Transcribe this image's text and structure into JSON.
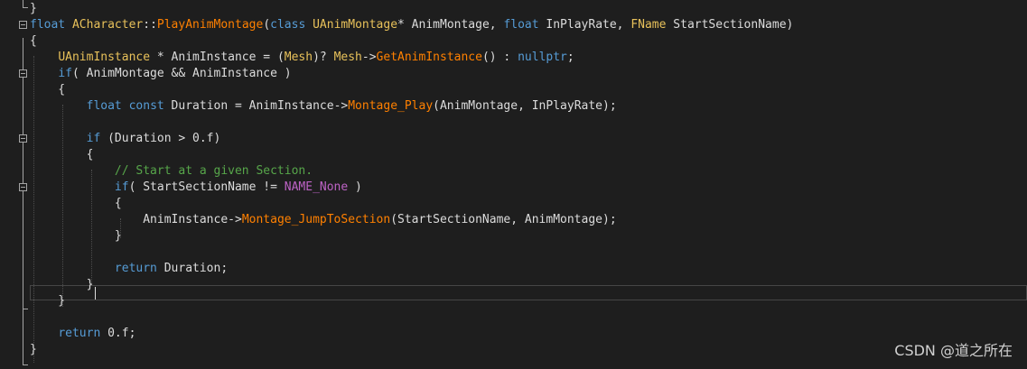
{
  "editor": {
    "background": "#1e1e1e",
    "colors": {
      "keyword": "#569cd6",
      "type": "#e8c15a",
      "function": "#ff8000",
      "plain": "#dcdcdc",
      "comment": "#57a64a",
      "macro": "#bd63c5"
    },
    "lines": [
      {
        "tokens": [
          {
            "t": "pl",
            "v": "}"
          }
        ]
      },
      {
        "tokens": [
          {
            "t": "kw",
            "v": "float"
          },
          {
            "t": "pl",
            "v": " "
          },
          {
            "t": "ty",
            "v": "ACharacter"
          },
          {
            "t": "pl",
            "v": "::"
          },
          {
            "t": "fn",
            "v": "PlayAnimMontage"
          },
          {
            "t": "pl",
            "v": "("
          },
          {
            "t": "kw",
            "v": "class"
          },
          {
            "t": "pl",
            "v": " "
          },
          {
            "t": "ty",
            "v": "UAnimMontage"
          },
          {
            "t": "pl",
            "v": "* AnimMontage, "
          },
          {
            "t": "kw",
            "v": "float"
          },
          {
            "t": "pl",
            "v": " InPlayRate, "
          },
          {
            "t": "ty",
            "v": "FName"
          },
          {
            "t": "pl",
            "v": " StartSectionName)"
          }
        ]
      },
      {
        "tokens": [
          {
            "t": "pl",
            "v": "{"
          }
        ]
      },
      {
        "tokens": [
          {
            "t": "pl",
            "v": "    "
          },
          {
            "t": "ty",
            "v": "UAnimInstance"
          },
          {
            "t": "pl",
            "v": " * AnimInstance = ("
          },
          {
            "t": "ty",
            "v": "Mesh"
          },
          {
            "t": "pl",
            "v": ")? "
          },
          {
            "t": "ty",
            "v": "Mesh"
          },
          {
            "t": "pl",
            "v": "->"
          },
          {
            "t": "fn",
            "v": "GetAnimInstance"
          },
          {
            "t": "pl",
            "v": "() : "
          },
          {
            "t": "kw",
            "v": "nullptr"
          },
          {
            "t": "pl",
            "v": ";"
          }
        ]
      },
      {
        "tokens": [
          {
            "t": "pl",
            "v": "    "
          },
          {
            "t": "kw",
            "v": "if"
          },
          {
            "t": "pl",
            "v": "( AnimMontage && AnimInstance )"
          }
        ]
      },
      {
        "tokens": [
          {
            "t": "pl",
            "v": "    {"
          }
        ]
      },
      {
        "tokens": [
          {
            "t": "pl",
            "v": "        "
          },
          {
            "t": "kw",
            "v": "float"
          },
          {
            "t": "pl",
            "v": " "
          },
          {
            "t": "kw",
            "v": "const"
          },
          {
            "t": "pl",
            "v": " Duration = AnimInstance->"
          },
          {
            "t": "fn",
            "v": "Montage_Play"
          },
          {
            "t": "pl",
            "v": "(AnimMontage, InPlayRate);"
          }
        ]
      },
      {
        "tokens": []
      },
      {
        "tokens": [
          {
            "t": "pl",
            "v": "        "
          },
          {
            "t": "kw",
            "v": "if"
          },
          {
            "t": "pl",
            "v": " (Duration > 0.f)"
          }
        ]
      },
      {
        "tokens": [
          {
            "t": "pl",
            "v": "        {"
          }
        ]
      },
      {
        "tokens": [
          {
            "t": "pl",
            "v": "            "
          },
          {
            "t": "cm",
            "v": "// Start at a given Section."
          }
        ]
      },
      {
        "tokens": [
          {
            "t": "pl",
            "v": "            "
          },
          {
            "t": "kw",
            "v": "if"
          },
          {
            "t": "pl",
            "v": "( StartSectionName != "
          },
          {
            "t": "mc",
            "v": "NAME_None"
          },
          {
            "t": "pl",
            "v": " )"
          }
        ]
      },
      {
        "tokens": [
          {
            "t": "pl",
            "v": "            {"
          }
        ]
      },
      {
        "tokens": [
          {
            "t": "pl",
            "v": "                AnimInstance->"
          },
          {
            "t": "fn",
            "v": "Montage_JumpToSection"
          },
          {
            "t": "pl",
            "v": "(StartSectionName, AnimMontage);"
          }
        ]
      },
      {
        "tokens": [
          {
            "t": "pl",
            "v": "            }"
          }
        ]
      },
      {
        "tokens": []
      },
      {
        "tokens": [
          {
            "t": "pl",
            "v": "            "
          },
          {
            "t": "kw",
            "v": "return"
          },
          {
            "t": "pl",
            "v": " Duration;"
          }
        ]
      },
      {
        "tokens": [
          {
            "t": "pl",
            "v": "        }"
          }
        ]
      },
      {
        "tokens": [
          {
            "t": "pl",
            "v": "    }"
          }
        ]
      },
      {
        "tokens": []
      },
      {
        "tokens": [
          {
            "t": "pl",
            "v": "    "
          },
          {
            "t": "kw",
            "v": "return"
          },
          {
            "t": "pl",
            "v": " 0.f;"
          }
        ]
      },
      {
        "tokens": [
          {
            "t": "pl",
            "v": "}"
          }
        ]
      }
    ],
    "fold_markers": [
      1,
      4,
      8,
      11
    ]
  },
  "watermark": {
    "text": "CSDN @道之所在"
  }
}
